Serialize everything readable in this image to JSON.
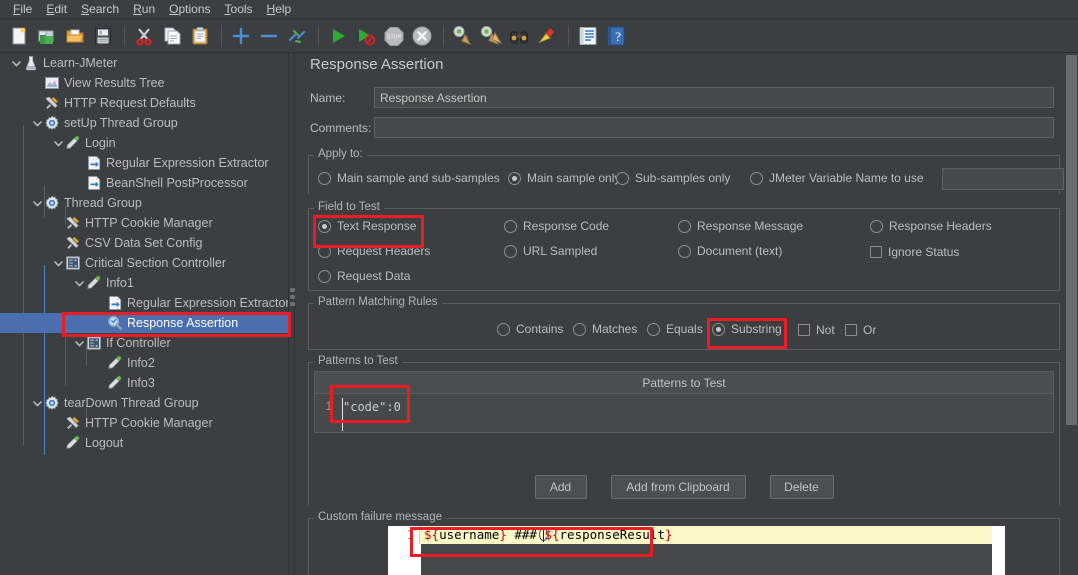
{
  "window": {
    "app": "Apache JMeter",
    "bg_color": "#3c3f41",
    "accent_selection": "#4b6eaf",
    "annotation_color": "#ec1c24"
  },
  "menubar": {
    "items": [
      {
        "label": "File",
        "mnemonic": "F"
      },
      {
        "label": "Edit",
        "mnemonic": "E"
      },
      {
        "label": "Search",
        "mnemonic": "S"
      },
      {
        "label": "Run",
        "mnemonic": "R"
      },
      {
        "label": "Options",
        "mnemonic": "O"
      },
      {
        "label": "Tools",
        "mnemonic": "T"
      },
      {
        "label": "Help",
        "mnemonic": "H"
      }
    ]
  },
  "toolbar": {
    "buttons": [
      {
        "icon": "new-file-icon",
        "tooltip": "New"
      },
      {
        "icon": "templates-icon",
        "tooltip": "Templates"
      },
      {
        "icon": "open-folder-icon",
        "tooltip": "Open"
      },
      {
        "icon": "save-floppy-icon",
        "tooltip": "Save"
      },
      {
        "icon": "cut-scissors-icon",
        "tooltip": "Cut"
      },
      {
        "icon": "copy-pages-icon",
        "tooltip": "Copy"
      },
      {
        "icon": "paste-clipboard-icon",
        "tooltip": "Paste"
      },
      {
        "icon": "expand-plus-icon",
        "tooltip": "Expand All"
      },
      {
        "icon": "collapse-minus-icon",
        "tooltip": "Collapse All"
      },
      {
        "icon": "toggle-icon",
        "tooltip": "Toggle"
      },
      {
        "icon": "start-play-icon",
        "tooltip": "Start"
      },
      {
        "icon": "start-no-timers-icon",
        "tooltip": "Start no pauses"
      },
      {
        "icon": "stop-icon",
        "tooltip": "Stop"
      },
      {
        "icon": "shutdown-icon",
        "tooltip": "Shutdown"
      },
      {
        "icon": "clear-broom-icon",
        "tooltip": "Clear"
      },
      {
        "icon": "clear-all-broom-icon",
        "tooltip": "Clear All"
      },
      {
        "icon": "search-binoculars-icon",
        "tooltip": "Search"
      },
      {
        "icon": "reset-search-broom-icon",
        "tooltip": "Reset Search"
      },
      {
        "icon": "function-helper-icon",
        "tooltip": "Function Helper Dialog"
      },
      {
        "icon": "help-book-icon",
        "tooltip": "Help"
      }
    ]
  },
  "tree": {
    "selected": "Response Assertion",
    "nodes": [
      {
        "label": "Learn-JMeter",
        "depth": 0,
        "icon": "jmeter-flask-icon",
        "twisty": "down"
      },
      {
        "label": "View Results Tree",
        "depth": 1,
        "icon": "view-results-tree-icon",
        "twisty": "none"
      },
      {
        "label": "HTTP Request Defaults",
        "depth": 1,
        "icon": "config-wrench-icon",
        "twisty": "none"
      },
      {
        "label": "setUp Thread Group",
        "depth": 1,
        "icon": "thread-group-gear-icon",
        "twisty": "down"
      },
      {
        "label": "Login",
        "depth": 2,
        "icon": "sampler-pipette-icon",
        "twisty": "down"
      },
      {
        "label": "Regular Expression Extractor",
        "depth": 3,
        "icon": "postprocessor-arrow-icon",
        "twisty": "none"
      },
      {
        "label": "BeanShell PostProcessor",
        "depth": 3,
        "icon": "postprocessor-arrow-icon",
        "twisty": "none"
      },
      {
        "label": "Thread Group",
        "depth": 1,
        "icon": "thread-group-gear-icon",
        "twisty": "down"
      },
      {
        "label": "HTTP Cookie Manager",
        "depth": 2,
        "icon": "config-wrench-icon",
        "twisty": "none"
      },
      {
        "label": "CSV Data Set Config",
        "depth": 2,
        "icon": "config-wrench-icon",
        "twisty": "none"
      },
      {
        "label": "Critical Section Controller",
        "depth": 2,
        "icon": "controller-icon",
        "twisty": "down"
      },
      {
        "label": "Info1",
        "depth": 3,
        "icon": "sampler-pipette-icon",
        "twisty": "down"
      },
      {
        "label": "Regular Expression Extractor",
        "depth": 4,
        "icon": "postprocessor-arrow-icon",
        "twisty": "none"
      },
      {
        "label": "Response Assertion",
        "depth": 4,
        "icon": "assertion-magnifier-icon",
        "twisty": "none"
      },
      {
        "label": "If Controller",
        "depth": 3,
        "icon": "controller-icon",
        "twisty": "down"
      },
      {
        "label": "Info2",
        "depth": 4,
        "icon": "sampler-pipette-icon",
        "twisty": "none"
      },
      {
        "label": "Info3",
        "depth": 4,
        "icon": "sampler-pipette-icon",
        "twisty": "none"
      },
      {
        "label": "tearDown Thread Group",
        "depth": 1,
        "icon": "thread-group-gear-icon",
        "twisty": "down"
      },
      {
        "label": "HTTP Cookie Manager",
        "depth": 2,
        "icon": "config-wrench-icon",
        "twisty": "none"
      },
      {
        "label": "Logout",
        "depth": 2,
        "icon": "sampler-pipette-icon",
        "twisty": "none"
      }
    ]
  },
  "panel": {
    "title": "Response Assertion",
    "name_label": "Name:",
    "name_value": "Response Assertion",
    "comments_label": "Comments:",
    "comments_value": "",
    "comments_placeholder": "",
    "apply_to": {
      "title": "Apply to:",
      "options": [
        {
          "label": "Main sample and sub-samples",
          "selected": false
        },
        {
          "label": "Main sample only",
          "selected": true
        },
        {
          "label": "Sub-samples only",
          "selected": false
        },
        {
          "label": "JMeter Variable Name to use",
          "selected": false
        }
      ],
      "variable_value": "",
      "variable_placeholder": ""
    },
    "field_to_test": {
      "title": "Field to Test",
      "options": [
        {
          "label": "Text Response",
          "type": "radio",
          "selected": true,
          "highlighted": true
        },
        {
          "label": "Response Code",
          "type": "radio",
          "selected": false,
          "highlighted": false
        },
        {
          "label": "Response Message",
          "type": "radio",
          "selected": false,
          "highlighted": false
        },
        {
          "label": "Response Headers",
          "type": "radio",
          "selected": false,
          "highlighted": false
        },
        {
          "label": "Request Headers",
          "type": "radio",
          "selected": false,
          "highlighted": false
        },
        {
          "label": "URL Sampled",
          "type": "radio",
          "selected": false,
          "highlighted": false
        },
        {
          "label": "Document (text)",
          "type": "radio",
          "selected": false,
          "highlighted": false
        },
        {
          "label": "Ignore Status",
          "type": "checkbox",
          "selected": false,
          "highlighted": false
        },
        {
          "label": "Request Data",
          "type": "radio",
          "selected": false,
          "highlighted": false
        }
      ]
    },
    "pattern_matching_rules": {
      "title": "Pattern Matching Rules",
      "options": [
        {
          "label": "Contains",
          "type": "radio",
          "selected": false,
          "highlighted": false
        },
        {
          "label": "Matches",
          "type": "radio",
          "selected": false,
          "highlighted": false
        },
        {
          "label": "Equals",
          "type": "radio",
          "selected": false,
          "highlighted": false
        },
        {
          "label": "Substring",
          "type": "radio",
          "selected": true,
          "highlighted": true
        },
        {
          "label": "Not",
          "type": "checkbox",
          "selected": false,
          "highlighted": false
        },
        {
          "label": "Or",
          "type": "checkbox",
          "selected": false,
          "highlighted": false
        }
      ]
    },
    "patterns_to_test": {
      "title": "Patterns to Test",
      "column_header": "Patterns to Test",
      "rows": [
        {
          "num": "1",
          "value": "\"code\":0",
          "highlighted": true
        }
      ]
    },
    "buttons": {
      "add": "Add",
      "add_from_clipboard": "Add from Clipboard",
      "delete": "Delete"
    },
    "custom_failure_message": {
      "title": "Custom failure message",
      "line_number": "1",
      "value": "${username} ### ${responseResult}",
      "segments": [
        {
          "text": "${",
          "color": "#d40000"
        },
        {
          "text": "username",
          "color": "#000000"
        },
        {
          "text": "}",
          "color": "#d40000"
        },
        {
          "text": " ### ",
          "color": "#000000"
        },
        {
          "text": "${",
          "color": "#d40000"
        },
        {
          "text": "responseResult",
          "color": "#000000"
        },
        {
          "text": "}",
          "color": "#d40000"
        }
      ],
      "highlighted": true
    }
  }
}
